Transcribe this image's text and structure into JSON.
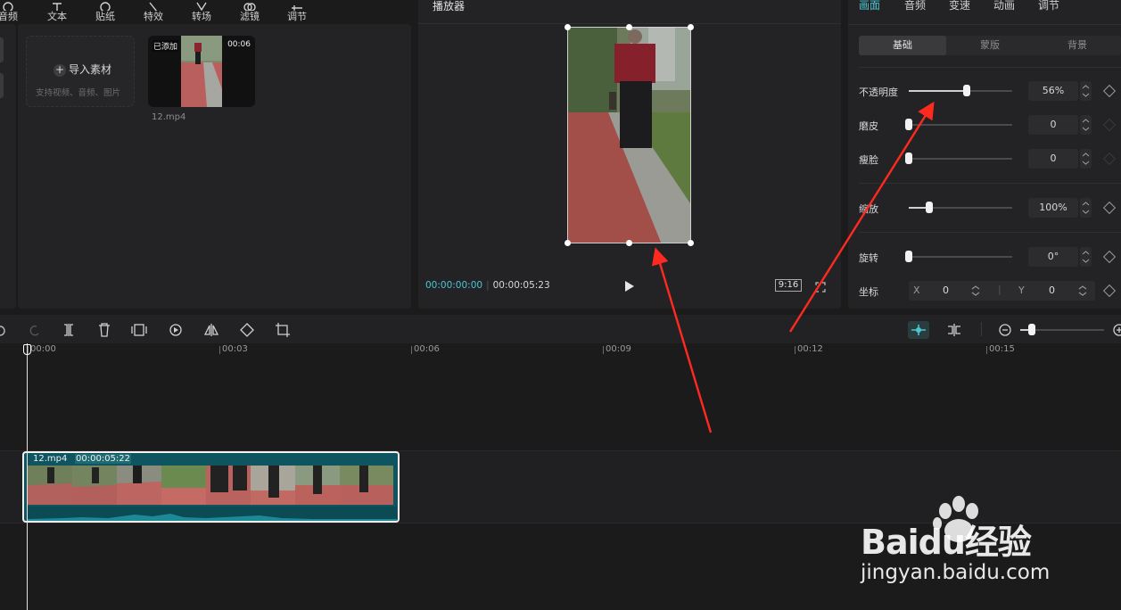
{
  "toolbar": {
    "items": [
      {
        "label": "音频",
        "icon": "audio-icon"
      },
      {
        "label": "文本",
        "icon": "text-icon"
      },
      {
        "label": "贴纸",
        "icon": "sticker-icon"
      },
      {
        "label": "特效",
        "icon": "effects-icon"
      },
      {
        "label": "转场",
        "icon": "transition-icon"
      },
      {
        "label": "滤镜",
        "icon": "filter-icon"
      },
      {
        "label": "调节",
        "icon": "adjust-icon"
      }
    ]
  },
  "media": {
    "import_label": "导入素材",
    "import_hint": "支持视频、音频、图片",
    "clip": {
      "badge": "已添加",
      "duration": "00:06",
      "filename": "12.mp4"
    }
  },
  "player": {
    "title": "播放器",
    "current_time": "00:00:00:00",
    "total_time": "00:00:05:23",
    "ratio": "9:16"
  },
  "inspector": {
    "tabs": [
      "画面",
      "音频",
      "变速",
      "动画",
      "调节"
    ],
    "active_tab": "画面",
    "subtabs": [
      "基础",
      "蒙版",
      "背景"
    ],
    "active_subtab": "基础",
    "params": [
      {
        "label": "不透明度",
        "value": "56%",
        "level": 0.56
      },
      {
        "label": "磨皮",
        "value": "0",
        "level": 0
      },
      {
        "label": "瘦脸",
        "value": "0",
        "level": 0
      },
      {
        "label": "缩放",
        "value": "100%",
        "level": 0.2
      },
      {
        "label": "旋转",
        "value": "0°",
        "level": 0
      }
    ],
    "position": {
      "label": "坐标",
      "x_label": "X",
      "x_value": "0",
      "y_label": "Y",
      "y_value": "0"
    }
  },
  "timeline": {
    "ticks": [
      "00:00",
      "00:03",
      "00:06",
      "00:09",
      "00:12",
      "00:15"
    ],
    "clip_name": "12.mp4",
    "clip_duration": "00:00:05:22"
  },
  "watermark": {
    "brand": "Baidu经验",
    "url": "jingyan.baidu.com"
  },
  "colors": {
    "accent": "#4bc6d1",
    "clip_bg": "#0f5560",
    "arrow": "#ff2a1f"
  }
}
